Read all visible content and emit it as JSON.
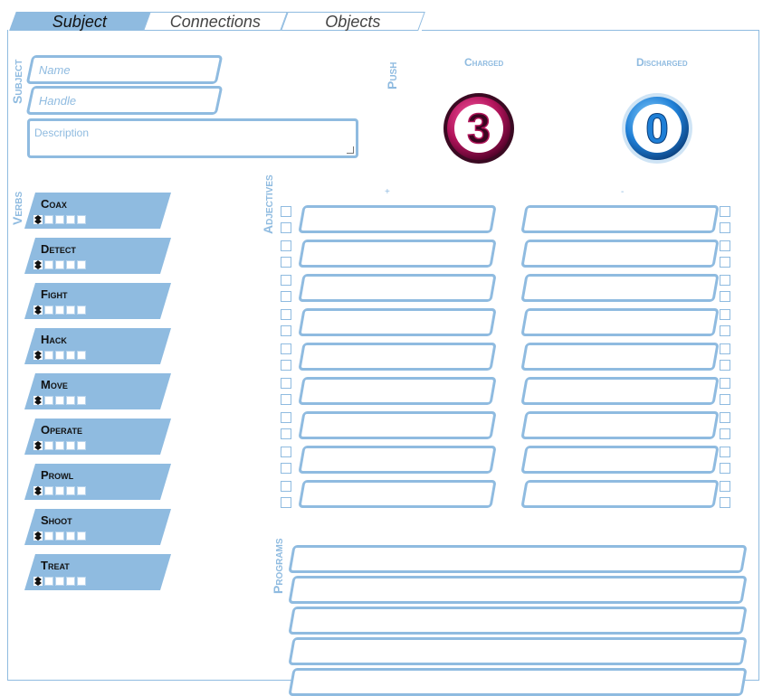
{
  "tabs": [
    {
      "label": "Subject",
      "active": true
    },
    {
      "label": "Connections",
      "active": false
    },
    {
      "label": "Objects",
      "active": false
    }
  ],
  "subject": {
    "section_label": "Subject",
    "name_placeholder": "Name",
    "handle_placeholder": "Handle",
    "description_placeholder": "Description"
  },
  "push": {
    "label": "Push",
    "charged_label": "Charged",
    "charged_value": "3",
    "discharged_label": "Discharged",
    "discharged_value": "0"
  },
  "verbs": {
    "label": "Verbs",
    "items": [
      "Coax",
      "Detect",
      "Fight",
      "Hack",
      "Move",
      "Operate",
      "Prowl",
      "Shoot",
      "Treat"
    ]
  },
  "adjectives": {
    "label": "Adjectives",
    "plus_mark": "+",
    "minus_mark": "-"
  },
  "programs": {
    "label": "Programs"
  },
  "colors": {
    "accent": "#8fbbe0",
    "charged": "#b0145a",
    "discharged": "#1f7fd6"
  }
}
